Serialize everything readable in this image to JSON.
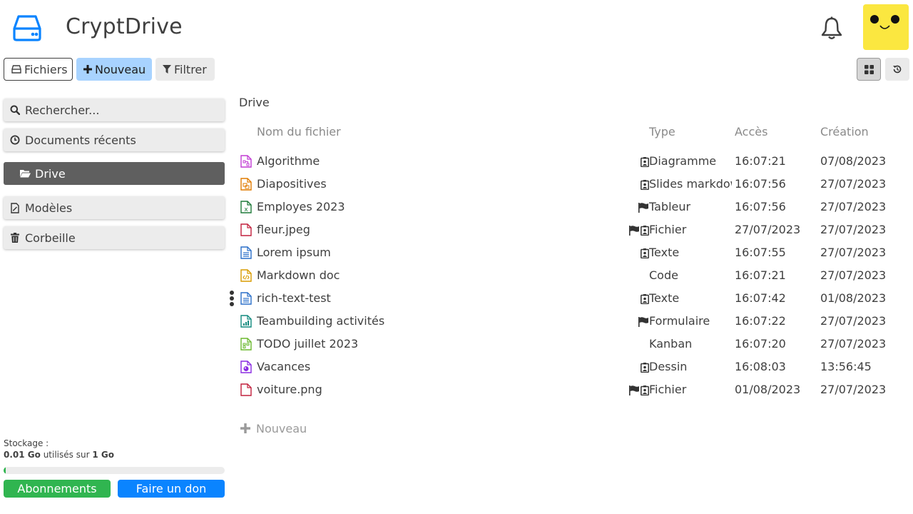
{
  "header": {
    "title": "CryptDrive"
  },
  "toolbar": {
    "files_label": "Fichiers",
    "new_label": "Nouveau",
    "filter_label": "Filtrer"
  },
  "sidebar": {
    "items": [
      {
        "label": "Rechercher..."
      },
      {
        "label": "Documents récents"
      },
      {
        "label": "Drive"
      },
      {
        "label": "Modèles"
      },
      {
        "label": "Corbeille"
      }
    ]
  },
  "storage": {
    "label": "Stockage :",
    "used": "0.01 Go",
    "middle": " utilisés sur ",
    "total": "1 Go",
    "fraction": 0.01
  },
  "footer": {
    "subscribe_label": "Abonnements",
    "donate_label": "Faire un don"
  },
  "main": {
    "breadcrumb": "Drive",
    "columns": {
      "name": "Nom du fichier",
      "type": "Type",
      "access": "Accès",
      "created": "Création"
    },
    "files": [
      {
        "name": "Algorithme",
        "type": "Diagramme",
        "access": "16:07:21",
        "created": "07/08/2023",
        "icon": "diagram-icon",
        "color": "#c23bd4",
        "flags": [
          "owner"
        ]
      },
      {
        "name": "Diapositives",
        "type": "Slides markdown",
        "access": "16:07:56",
        "created": "27/07/2023",
        "icon": "slides-icon",
        "color": "#e07b00",
        "flags": [
          "owner"
        ]
      },
      {
        "name": "Employes 2023",
        "type": "Tableur",
        "access": "16:07:56",
        "created": "27/07/2023",
        "icon": "spreadsheet-icon",
        "color": "#1f7a3a",
        "flags": [
          "flag"
        ]
      },
      {
        "name": "fleur.jpeg",
        "type": "Fichier",
        "access": "27/07/2023",
        "created": "27/07/2023",
        "icon": "file-icon",
        "color": "#c2203d",
        "flags": [
          "flag",
          "owner"
        ]
      },
      {
        "name": "Lorem ipsum",
        "type": "Texte",
        "access": "16:07:55",
        "created": "27/07/2023",
        "icon": "text-doc-icon",
        "color": "#2a6fc9",
        "flags": [
          "owner"
        ]
      },
      {
        "name": "Markdown doc",
        "type": "Code",
        "access": "16:07:21",
        "created": "27/07/2023",
        "icon": "code-icon",
        "color": "#d89b00",
        "flags": []
      },
      {
        "name": "rich-text-test",
        "type": "Texte",
        "access": "16:07:42",
        "created": "01/08/2023",
        "icon": "text-doc-icon",
        "color": "#2a6fc9",
        "flags": [
          "owner"
        ]
      },
      {
        "name": "Teambuilding activités",
        "type": "Formulaire",
        "access": "16:07:22",
        "created": "27/07/2023",
        "icon": "form-icon",
        "color": "#118a7e",
        "flags": [
          "flag"
        ]
      },
      {
        "name": "TODO juillet 2023",
        "type": "Kanban",
        "access": "16:07:20",
        "created": "27/07/2023",
        "icon": "kanban-icon",
        "color": "#6bb82f",
        "flags": []
      },
      {
        "name": "Vacances",
        "type": "Dessin",
        "access": "16:08:03",
        "created": "13:56:45",
        "icon": "drawing-icon",
        "color": "#8a2be2",
        "flags": [
          "owner"
        ]
      },
      {
        "name": "voiture.png",
        "type": "Fichier",
        "access": "01/08/2023",
        "created": "27/07/2023",
        "icon": "file-icon",
        "color": "#c2203d",
        "flags": [
          "flag",
          "owner"
        ]
      }
    ],
    "add_new_label": "Nouveau"
  }
}
